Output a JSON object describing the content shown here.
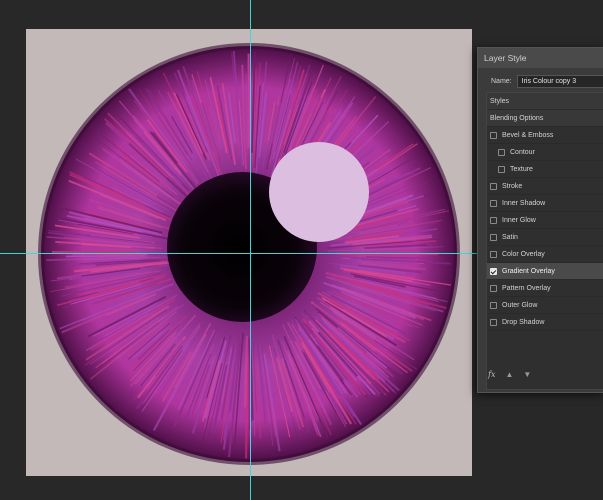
{
  "dialog": {
    "title": "Layer Style",
    "name_label": "Name:",
    "name_value": "Iris Colour copy 3",
    "items": [
      {
        "label": "Styles",
        "type": "header",
        "checked": false
      },
      {
        "label": "Blending Options",
        "type": "header",
        "checked": false
      },
      {
        "label": "Bevel & Emboss",
        "type": "check",
        "checked": false
      },
      {
        "label": "Contour",
        "type": "sub",
        "checked": false
      },
      {
        "label": "Texture",
        "type": "sub",
        "checked": false
      },
      {
        "label": "Stroke",
        "type": "check",
        "checked": false
      },
      {
        "label": "Inner Shadow",
        "type": "check",
        "checked": false
      },
      {
        "label": "Inner Glow",
        "type": "check",
        "checked": false
      },
      {
        "label": "Satin",
        "type": "check",
        "checked": false
      },
      {
        "label": "Color Overlay",
        "type": "check",
        "checked": false
      },
      {
        "label": "Gradient Overlay",
        "type": "check",
        "checked": true
      },
      {
        "label": "Pattern Overlay",
        "type": "check",
        "checked": false
      },
      {
        "label": "Outer Glow",
        "type": "check",
        "checked": false
      },
      {
        "label": "Drop Shadow",
        "type": "check",
        "checked": false
      }
    ],
    "fx_icon": "fx-icon",
    "up_icon": "arrow-up-icon",
    "down_icon": "arrow-down-icon"
  },
  "colors": {
    "canvas_bg": "#c3b9b9",
    "iris_main": "#a2359e",
    "iris_red": "#c81e5a",
    "highlight": "#dcbfe0",
    "guide": "#3fd6d6"
  }
}
